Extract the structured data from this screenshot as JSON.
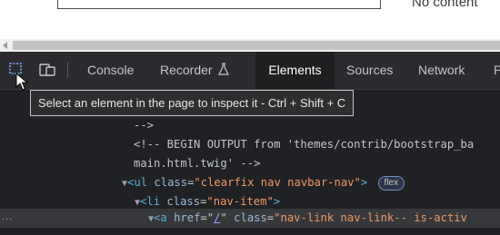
{
  "page": {
    "content_text": "No content"
  },
  "devtools": {
    "tabs": [
      {
        "label": "Console",
        "active": false
      },
      {
        "label": "Recorder",
        "active": false
      },
      {
        "label": "Elements",
        "active": true
      },
      {
        "label": "Sources",
        "active": false
      },
      {
        "label": "Network",
        "active": false
      },
      {
        "label": "P",
        "active": false
      }
    ],
    "icons": {
      "inspect": "inspect-element-icon",
      "device": "device-toolbar-icon",
      "recorder": "flask-icon"
    },
    "tooltip": "Select an element in the page to inspect it - Ctrl + Shift + C"
  },
  "code": {
    "line1": "-->",
    "line2": "<!-- BEGIN OUTPUT from 'themes/contrib/bootstrap_ba",
    "line3": "main.html.twig' -->",
    "line4": {
      "tag_open": "<ul",
      "attr": "class",
      "value": "\"clearfix nav navbar-nav\"",
      "tag_close": ">",
      "badge": "flex"
    },
    "line5": {
      "tag_open": "<li",
      "attr": "class",
      "value": "\"nav-item\"",
      "tag_close": ">"
    },
    "line6": {
      "tag_open": "<a",
      "attr1": "href",
      "href": "/",
      "attr2": "class",
      "value": "\"nav-link nav-link-- is-activ"
    },
    "dots": "..."
  },
  "colors": {
    "devtools_bg": "#202124",
    "tag": "#5db0d7",
    "attr_value": "#f29766",
    "attr_name": "#9bbbdc"
  }
}
